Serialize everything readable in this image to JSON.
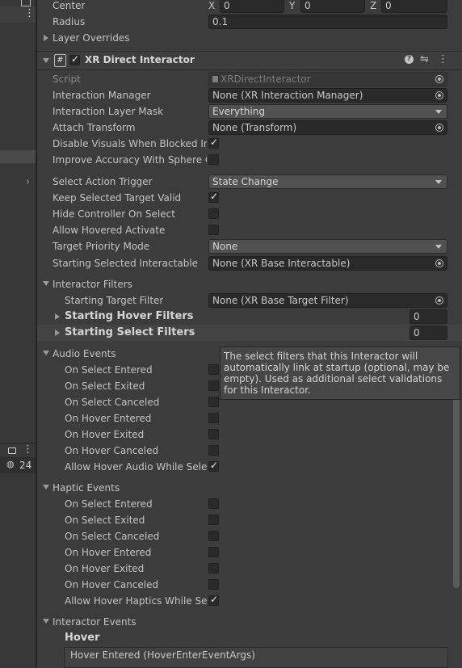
{
  "left_panel": {
    "top_icon": "window-icon",
    "kebab": "kebab-menu-icon",
    "lock": "lock-icon",
    "hidden_count": "24",
    "chevron": "chevron-right-icon"
  },
  "transform_rows": {
    "center_label": "Center",
    "x_label": "X",
    "x_value": "0",
    "y_label": "Y",
    "y_value": "0",
    "z_label": "Z",
    "z_value": "0",
    "radius_label": "Radius",
    "radius_value": "0.1",
    "layer_overrides_label": "Layer Overrides"
  },
  "component": {
    "title": "XR Direct Interactor",
    "icon": "script-hash-icon",
    "help_icon": "help-icon",
    "settings_icon": "preset-sliders-icon",
    "menu_icon": "kebab-menu-icon"
  },
  "fields": {
    "script_label": "Script",
    "script_value": "XRDirectInteractor",
    "interaction_manager_label": "Interaction Manager",
    "interaction_manager_value": "None (XR Interaction Manager)",
    "layer_mask_label": "Interaction Layer Mask",
    "layer_mask_value": "Everything",
    "attach_label": "Attach Transform",
    "attach_value": "None (Transform)",
    "disable_visuals_label": "Disable Visuals When Blocked In Gr",
    "improve_accuracy_label": "Improve Accuracy With Sphere Coll",
    "select_trigger_label": "Select Action Trigger",
    "select_trigger_value": "State Change",
    "keep_selected_label": "Keep Selected Target Valid",
    "hide_controller_label": "Hide Controller On Select",
    "allow_hovered_label": "Allow Hovered Activate",
    "priority_mode_label": "Target Priority Mode",
    "priority_mode_value": "None",
    "starting_selected_label": "Starting Selected Interactable",
    "starting_selected_value": "None (XR Base Interactable)"
  },
  "interactor_filters": {
    "header": "Interactor Filters",
    "target_filter_label": "Starting Target Filter",
    "target_filter_value": "None (XR Base Target Filter)",
    "hover_filters_label": "Starting Hover Filters",
    "hover_filters_value": "0",
    "select_filters_label": "Starting Select Filters",
    "select_filters_value": "0"
  },
  "audio_events": {
    "header": "Audio Events",
    "items": [
      "On Select Entered",
      "On Select Exited",
      "On Select Canceled",
      "On Hover Entered",
      "On Hover Exited",
      "On Hover Canceled",
      "Allow Hover Audio While Selecting"
    ]
  },
  "haptic_events": {
    "header": "Haptic Events",
    "items": [
      "On Select Entered",
      "On Select Exited",
      "On Select Canceled",
      "On Hover Entered",
      "On Hover Exited",
      "On Hover Canceled",
      "Allow Hover Haptics While Selecting"
    ]
  },
  "interactor_events": {
    "header": "Interactor Events",
    "hover_label": "Hover",
    "hover_entered": "Hover Entered (HoverEnterEventArgs)"
  },
  "tooltip": {
    "text": "The select filters that this Interactor will automatically link at startup (optional, may be empty). Used as additional select validations for this Interactor."
  }
}
